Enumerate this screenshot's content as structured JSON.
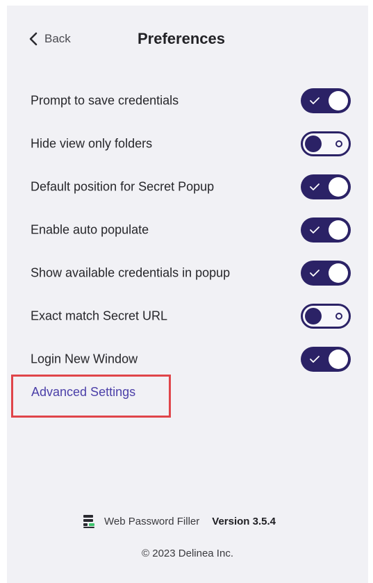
{
  "header": {
    "back_label": "Back",
    "title": "Preferences"
  },
  "settings": [
    {
      "label": "Prompt to save credentials",
      "enabled": true
    },
    {
      "label": "Hide view only folders",
      "enabled": false
    },
    {
      "label": "Default position for Secret Popup",
      "enabled": true
    },
    {
      "label": "Enable auto populate",
      "enabled": true
    },
    {
      "label": "Show available credentials in popup",
      "enabled": true
    },
    {
      "label": "Exact match Secret URL",
      "enabled": false
    },
    {
      "label": "Login New Window",
      "enabled": true
    }
  ],
  "advanced_link": "Advanced Settings",
  "footer": {
    "app_name": "Web Password Filler",
    "version": "Version 3.5.4",
    "copyright": "© 2023 Delinea Inc."
  },
  "colors": {
    "accent": "#2b2266",
    "link": "#4b3fa8",
    "highlight": "#e0454a",
    "background": "#f1f1f5",
    "logo_green": "#3ec46d"
  },
  "icons": {
    "back": "chevron-left-icon",
    "toggle_on": "check-icon",
    "toggle_off": "ring-icon",
    "app": "web-password-filler-icon"
  }
}
